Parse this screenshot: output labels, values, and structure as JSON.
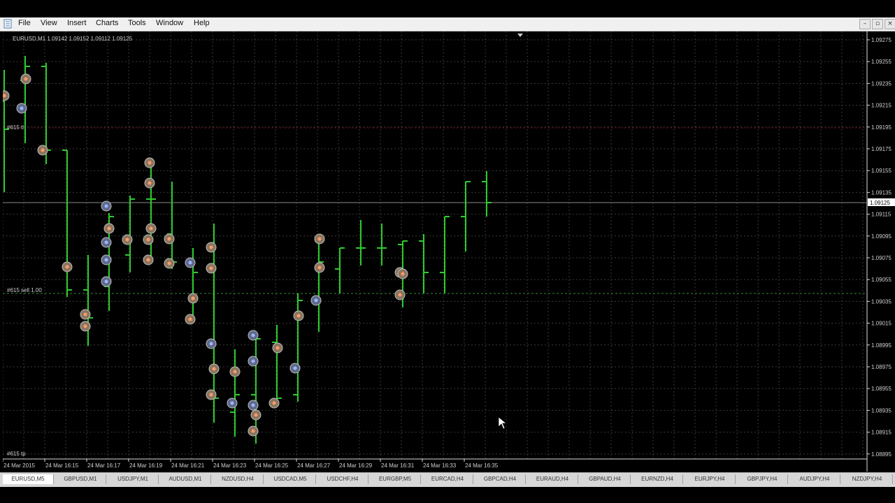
{
  "menubar": {
    "items": [
      "File",
      "View",
      "Insert",
      "Charts",
      "Tools",
      "Window",
      "Help"
    ],
    "window_controls": [
      "–",
      "▫",
      "×"
    ]
  },
  "chart": {
    "header": "EURUSD,M1  1.09142 1.09152 1.09112 1.09125",
    "price_labels": [
      "1.09275",
      "1.09255",
      "1.09235",
      "1.09215",
      "1.09195",
      "1.09175",
      "1.09155",
      "1.09135",
      "1.09115",
      "1.09095",
      "1.09075",
      "1.09055",
      "1.09035",
      "1.09015",
      "1.08995",
      "1.08975",
      "1.08955",
      "1.08935",
      "1.08915",
      "1.08895"
    ],
    "current_price": "1.09125",
    "time_labels": [
      "24 Mar 2015",
      "24 Mar 16:15",
      "24 Mar 16:17",
      "24 Mar 16:19",
      "24 Mar 16:21",
      "24 Mar 16:23",
      "24 Mar 16:25",
      "24 Mar 16:27",
      "24 Mar 16:29",
      "24 Mar 16:31",
      "24 Mar 16:33",
      "24 Mar 16:35"
    ],
    "order_labels": [
      "#615 tl",
      "#615 sell 1.00",
      "#615 tp"
    ],
    "colors": {
      "bars": "#2ecc2e",
      "grid": "#3a3a3a",
      "axis_text": "#cfcfcf",
      "sell_marker": "#c08070",
      "buy_marker": "#7080c0",
      "order_line": "#6a1010"
    }
  },
  "tabs": [
    "EURUSD,M5",
    "GBPUSD,M1",
    "USDJPY,M1",
    "AUDUSD,M1",
    "NZDUSD,H4",
    "USDCAD,M5",
    "USDCHF,H4",
    "EURGBP,M5",
    "EURCAD,H4",
    "GBPCAD,H4",
    "EURAUD,H4",
    "GBPAUD,H4",
    "EURNZD,H4",
    "EURJPY,H4",
    "GBPJPY,H4",
    "AUDJPY,H4",
    "NZDJPY,H4"
  ],
  "active_tab": "EURUSD,M5"
}
